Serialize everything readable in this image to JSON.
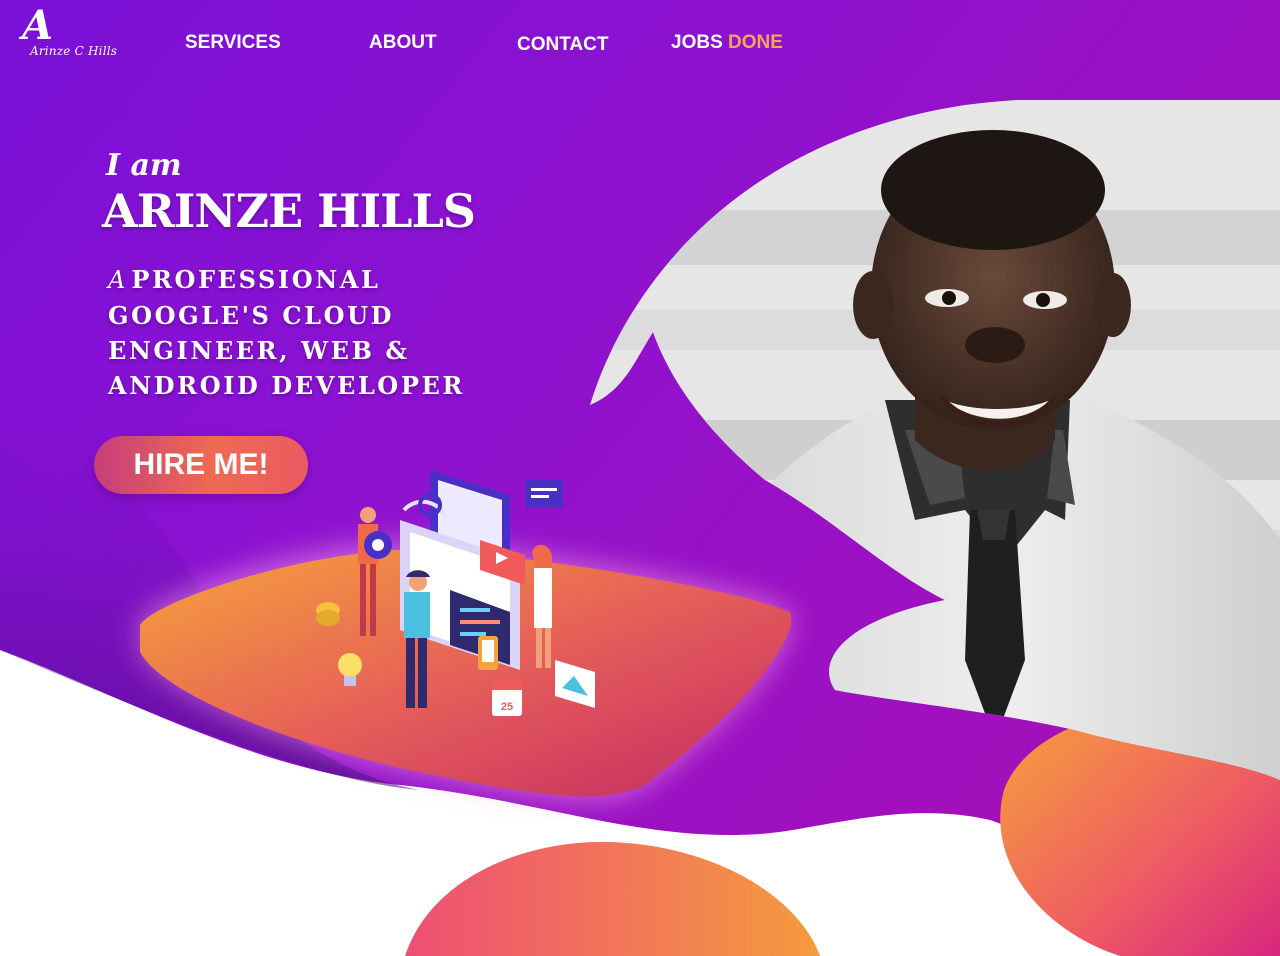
{
  "logo": {
    "letter": "A",
    "name": "Arinze C Hills"
  },
  "nav": {
    "services": "SERVICES",
    "about": "ABOUT",
    "contact": "CONTACT",
    "jobs": "JOBS",
    "done": "DONE"
  },
  "hero": {
    "intro": "I am",
    "name": "ARINZE HILLS",
    "tagline_prefix": "A",
    "tagline": "PROFESSIONAL GOOGLE'S CLOUD ENGINEER, WEB & ANDROID DEVELOPER",
    "cta_label": "HIRE ME!"
  },
  "illustration": {
    "calendar_day": "25"
  },
  "colors": {
    "purple_main": "#8a0fd6",
    "magenta": "#b51fb0",
    "orange": "#f6a23a",
    "pink_red": "#e8386a",
    "nav_accent": "#f6a45a"
  },
  "icons": {
    "hero_illustration": "isometric-developer-team-illustration",
    "portrait": "profile-photo"
  }
}
